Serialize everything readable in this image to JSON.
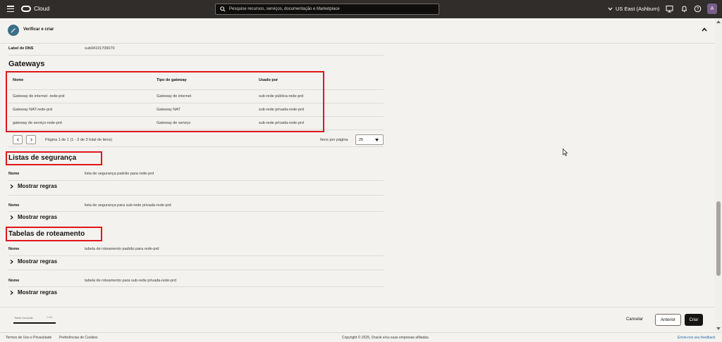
{
  "topbar": {
    "brand": "Cloud",
    "search_placeholder": "Pesquise recursos, serviços, documentação e Marketplace",
    "region": "US East (Ashburn)",
    "avatar_initial": "A"
  },
  "step": {
    "title": "Verificar e criar"
  },
  "dns": {
    "label": "Label de DNS",
    "value": "sub04191709070"
  },
  "gateways": {
    "heading": "Gateways",
    "columns": [
      "Nome",
      "Tipo de gateway",
      "Usado por"
    ],
    "rows": [
      [
        "Gateway de internet -rede-prd",
        "Gateway de internet",
        "sub-rede pública-rede-prd"
      ],
      [
        "Gateway NAT-rede-prd",
        "Gateway NAT",
        "sub-rede privada-rede-prd"
      ],
      [
        "gateway de serviço-rede-prd",
        "Gateway de serviço",
        "sub-rede privada-rede-prd"
      ]
    ],
    "pagination": {
      "info": "Página 1 de 1 (1 - 3 de 3 total de itens)",
      "items_per_page_label": "Itens por página",
      "items_per_page_value": "25"
    }
  },
  "security_lists": {
    "heading": "Listas de segurança",
    "items": [
      {
        "name_label": "Nome",
        "name": "lista de segurança padrão para rede-prd",
        "toggle": "Mostrar regras"
      },
      {
        "name_label": "Nome",
        "name": "lista de segurança para sub-rede privada-rede-prd",
        "toggle": "Mostrar regras"
      }
    ]
  },
  "route_tables": {
    "heading": "Tabelas de roteamento",
    "items": [
      {
        "name_label": "Nome",
        "name": "tabela de roteamento padrão para rede-prd",
        "toggle": "Mostrar regras"
      },
      {
        "name_label": "Nome",
        "name": "tabela de roteamento para sub-rede privada-rede-prd",
        "toggle": "Mostrar regras"
      }
    ]
  },
  "footer_bar": {
    "progress_label": "Tarefa Concluída",
    "progress_count": "1 of 1",
    "progress_fraction": 1.0,
    "cancel_label": "Cancelar",
    "previous_label": "Anterior",
    "create_label": "Criar"
  },
  "page_footer": {
    "terms": "Termos de Uso e Privacidade",
    "cookies": "Preferências de Cookies",
    "copyright": "Copyright © 2025, Oracle e/ou suas empresas afiliadas.",
    "feedback": "Envie-nos seu feedback"
  },
  "colors": {
    "topbar": "#312d2a",
    "highlight": "#e0151b",
    "primary_button": "#161513",
    "step_circle": "#3b6e87"
  }
}
